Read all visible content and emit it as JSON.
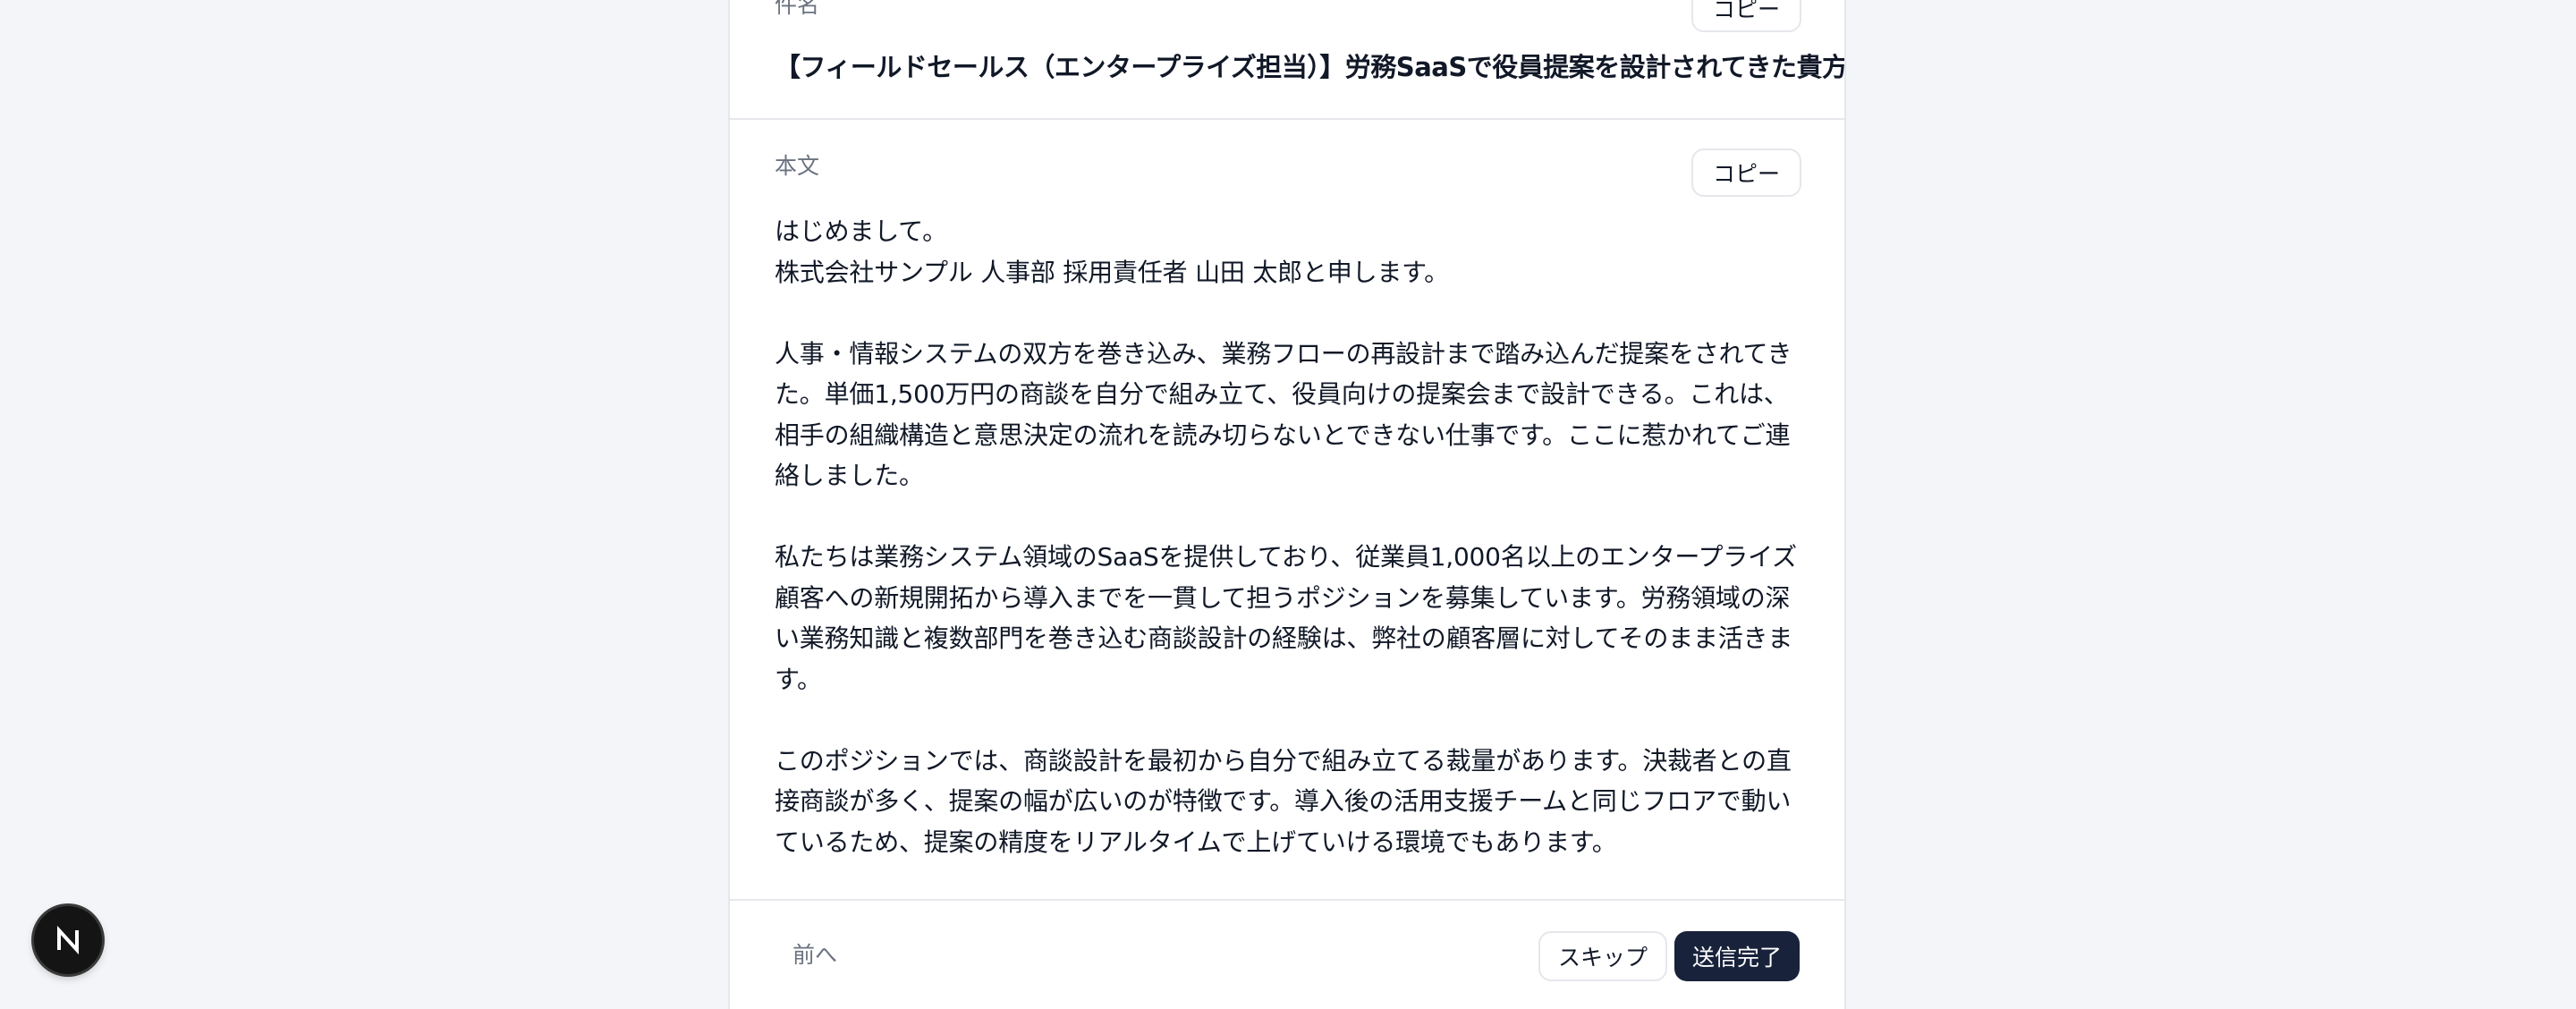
{
  "subject": {
    "label": "件名",
    "copy_label": "コピー",
    "text": "【フィールドセールス（エンタープライズ担当）】労務SaaSで役員提案を設計されてきた貴方へ"
  },
  "body": {
    "label": "本文",
    "copy_label": "コピー",
    "text": "はじめまして。\n株式会社サンプル 人事部 採用責任者 山田 太郎と申します。\n\n人事・情報システムの双方を巻き込み、業務フローの再設計まで踏み込んだ提案をされてきた。単価1,500万円の商談を自分で組み立て、役員向けの提案会まで設計できる。これは、相手の組織構造と意思決定の流れを読み切らないとできない仕事です。ここに惹かれてご連絡しました。\n\n私たちは業務システム領域のSaaSを提供しており、従業員1,000名以上のエンタープライズ顧客への新規開拓から導入までを一貫して担うポジションを募集しています。労務領域の深い業務知識と複数部門を巻き込む商談設計の経験は、弊社の顧客層に対してそのまま活きます。\n\nこのポジションでは、商談設計を最初から自分で組み立てる裁量があります。決裁者との直接商談が多く、提案の幅が広いのが特徴です。導入後の活用支援チームと同じフロアで動いているため、提案の精度をリアルタイムで上げていける環境でもあります。\n\nさらに、営業プロセスの型化はこれから本格的に取り組む段階です。これまでの商談設計の経験を、仕組みとして組織に残す仕事に関われます。個人の成果を出すだけでなく、営業の土台をつく"
  },
  "footer": {
    "prev_label": "前へ",
    "skip_label": "スキップ",
    "done_label": "送信完了"
  },
  "badge": {
    "letter": "N"
  }
}
